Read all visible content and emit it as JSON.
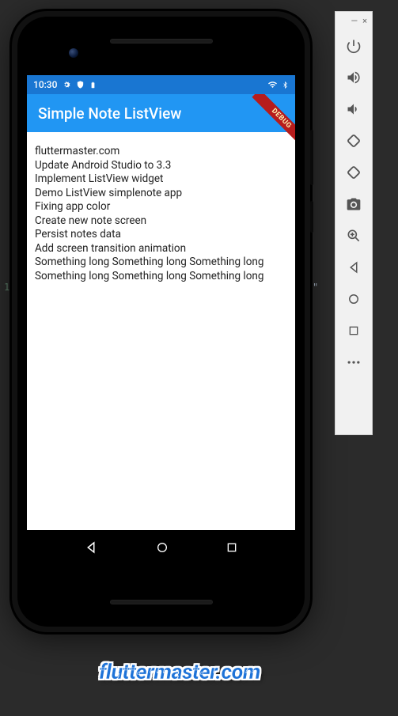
{
  "status": {
    "time": "10:30",
    "icons_left": [
      "gear-icon",
      "shield-icon",
      "battery-icon"
    ],
    "icons_right": [
      "wifi-icon",
      "bluetooth-icon"
    ]
  },
  "app": {
    "title": "Simple Note ListView",
    "debug_banner": "DEBUG"
  },
  "notes": [
    "fluttermaster.com",
    "Update Android Studio to 3.3",
    "Implement ListView widget",
    "Demo ListView simplenote app",
    "Fixing app color",
    "Create new note screen",
    "Persist notes data",
    "Add screen transition animation",
    "Something long Something long Something long Something long Something long Something long"
  ],
  "android_nav": {
    "back": "◀",
    "home": "●",
    "recent": "■"
  },
  "emulator_toolbar": {
    "minimize": "—",
    "close": "×",
    "buttons": [
      {
        "name": "power-icon"
      },
      {
        "name": "volume-up-icon"
      },
      {
        "name": "volume-down-icon"
      },
      {
        "name": "rotate-left-icon"
      },
      {
        "name": "rotate-right-icon"
      },
      {
        "name": "camera-icon"
      },
      {
        "name": "zoom-icon"
      },
      {
        "name": "back-icon"
      },
      {
        "name": "home-icon"
      },
      {
        "name": "overview-icon"
      },
      {
        "name": "more-icon"
      }
    ]
  },
  "watermark": "fluttermaster.com",
  "editor": {
    "line_number": "1",
    "cursor": "\""
  }
}
